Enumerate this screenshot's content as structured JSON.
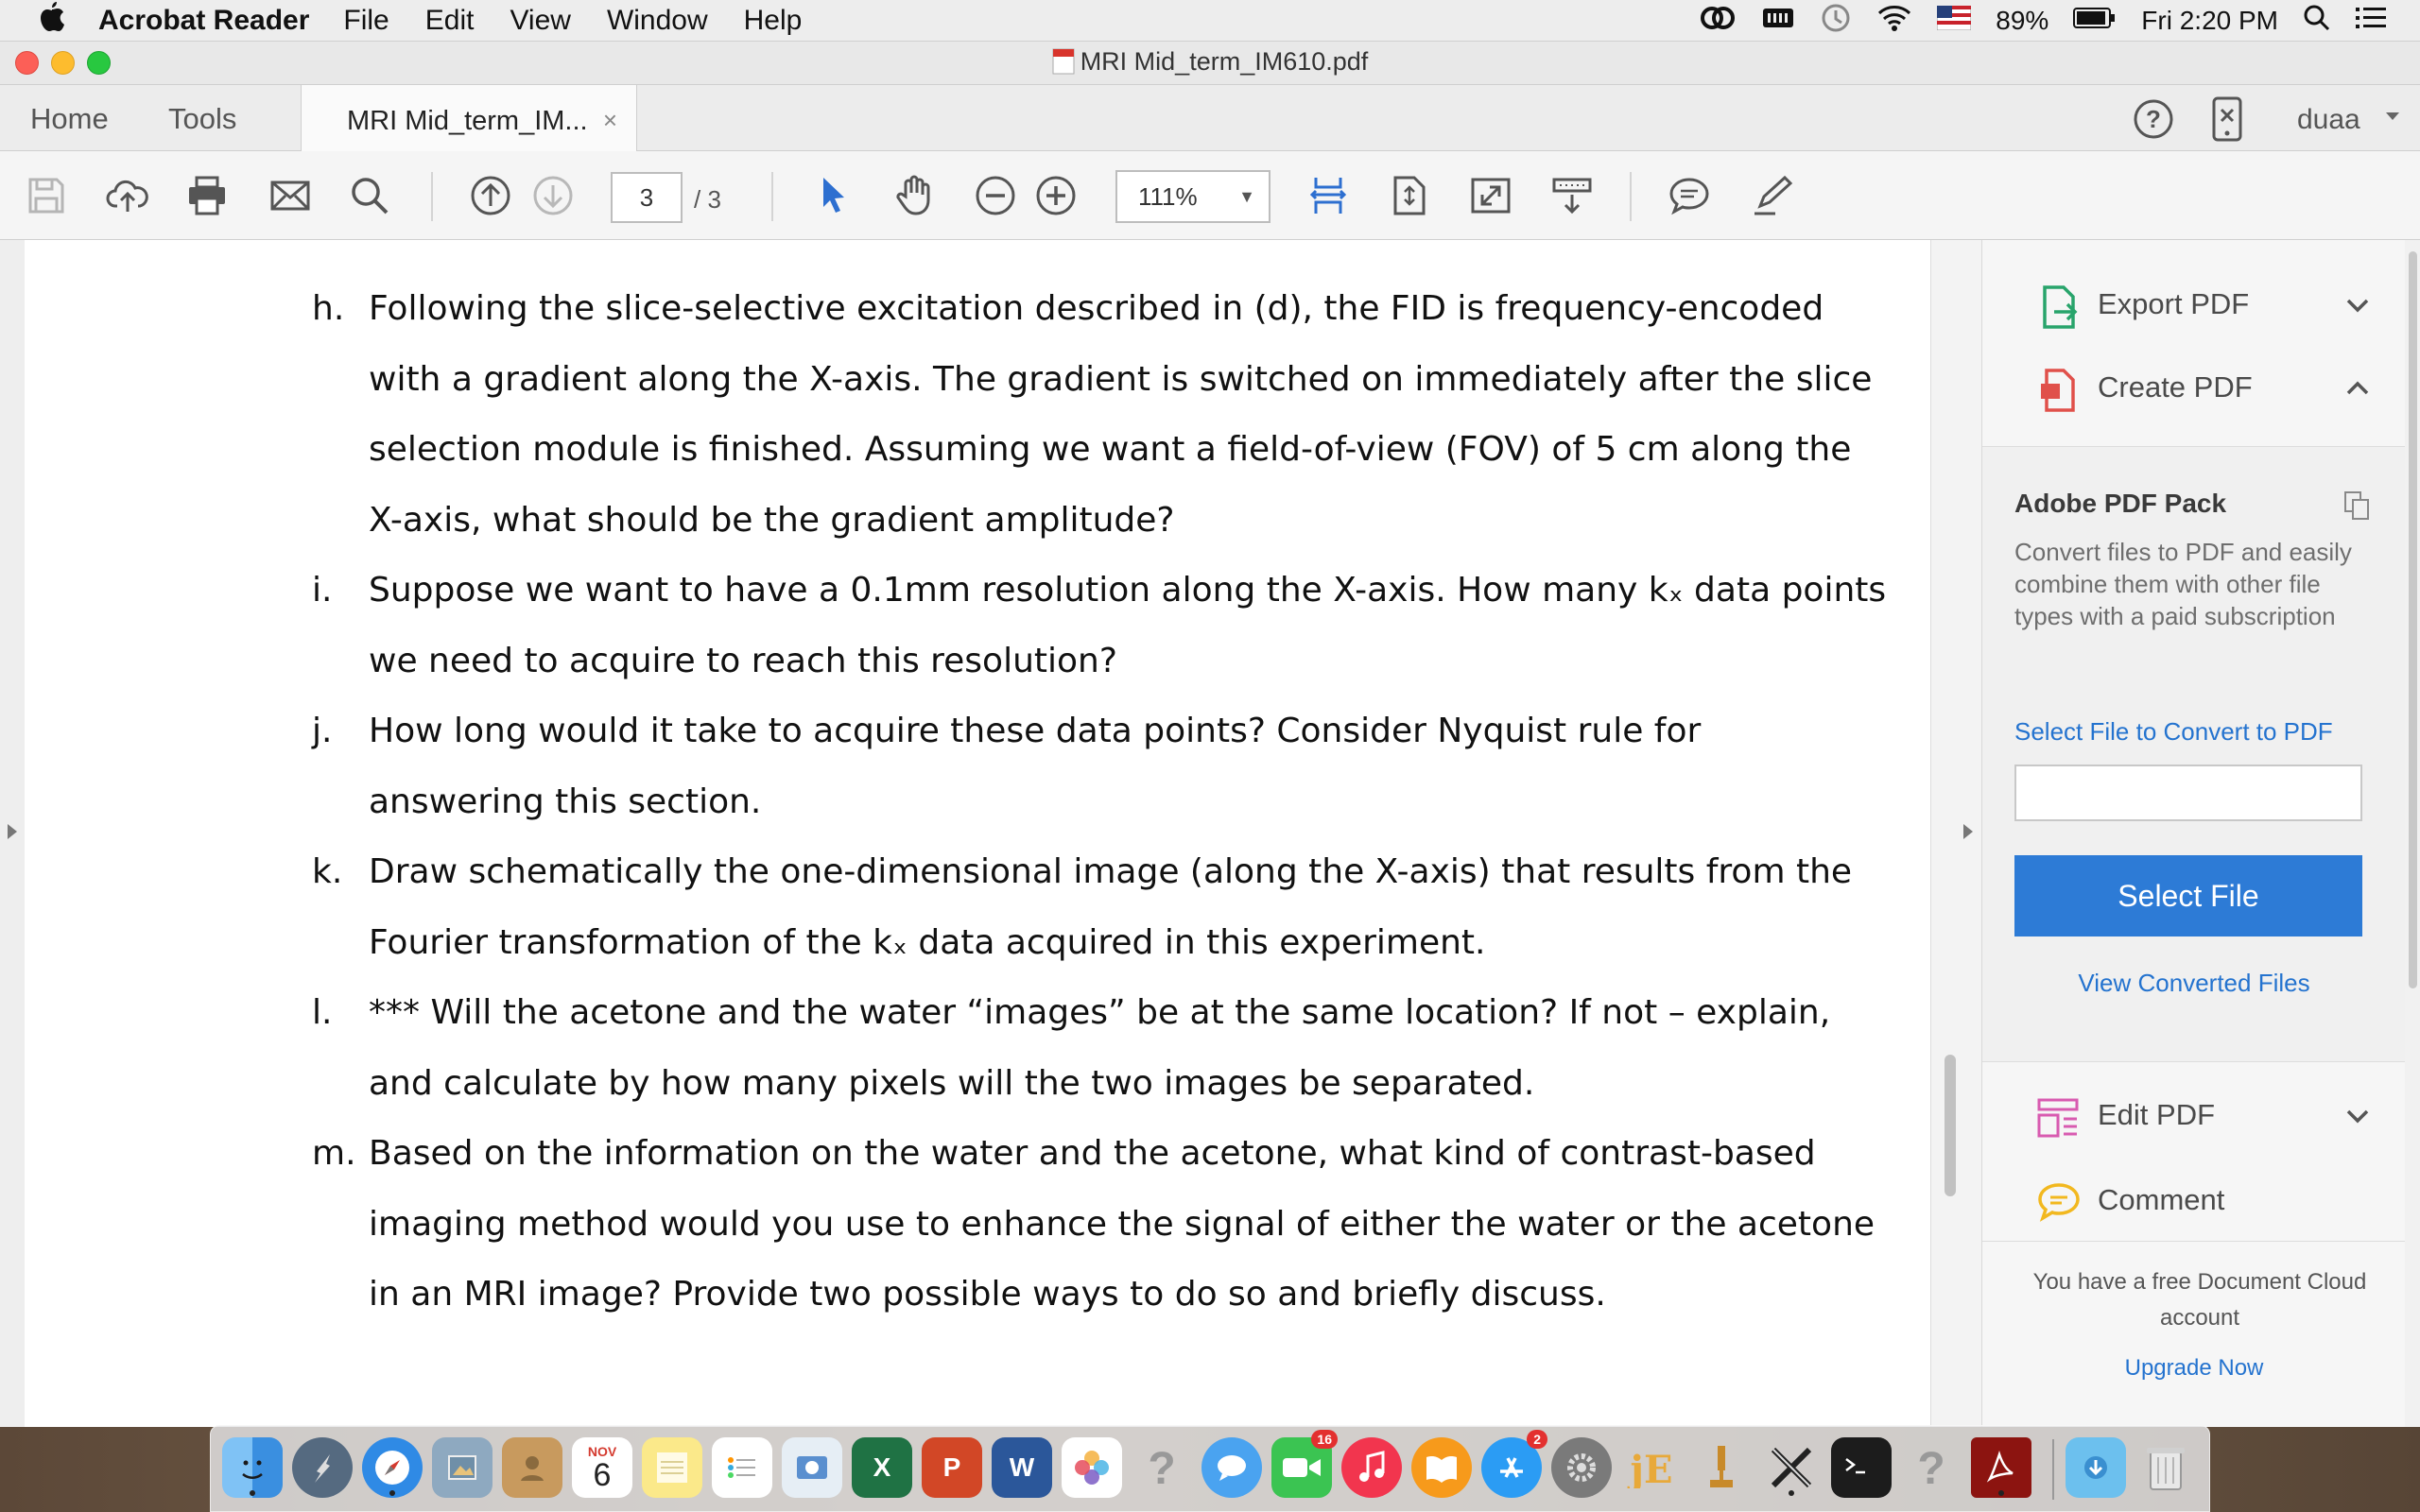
{
  "menubar": {
    "apple": "",
    "app_name": "Acrobat Reader",
    "items": [
      "File",
      "Edit",
      "View",
      "Window",
      "Help"
    ],
    "battery": "89%",
    "clock": "Fri 2:20 PM"
  },
  "window": {
    "title": "MRI Mid_term_IM610.pdf"
  },
  "tabs": {
    "home": "Home",
    "tools": "Tools",
    "doc_tab": "MRI Mid_term_IM...",
    "close": "×",
    "user": "duaa"
  },
  "toolbar": {
    "page_current": "3",
    "page_total": "/ 3",
    "zoom": "111%"
  },
  "document": {
    "questions": [
      {
        "label": "h.",
        "lines": [
          "Following the slice-selective excitation described in (d), the FID is frequency-encoded",
          "with a gradient along the X-axis. The gradient is switched on immediately after the slice",
          "selection module is finished. Assuming we want a field-of-view (FOV) of 5 cm along the",
          "X-axis, what should be the gradient amplitude?"
        ]
      },
      {
        "label": "i.",
        "lines": [
          "Suppose we want to have a 0.1mm resolution along the X-axis. How many kₓ data points",
          "we need to acquire to reach this resolution?"
        ]
      },
      {
        "label": "j.",
        "lines": [
          "How long would it take to acquire these data points? Consider Nyquist rule for",
          "answering this section."
        ]
      },
      {
        "label": "k.",
        "lines": [
          "Draw schematically the one-dimensional image (along the X-axis) that results from the",
          "Fourier transformation of the kₓ data acquired in this experiment."
        ]
      },
      {
        "label": "l.",
        "lines": [
          "*** Will the acetone and the water “images” be at the same location? If not – explain,",
          "and calculate by how many pixels will the two images be separated."
        ]
      },
      {
        "label": "m.",
        "lines": [
          "Based on the information on the water and the acetone, what kind of contrast-based",
          "imaging method would you use to enhance the signal of either the water or the acetone",
          "in an MRI image? Provide two possible ways to do so and briefly discuss."
        ]
      }
    ]
  },
  "panel": {
    "export_pdf": "Export PDF",
    "create_pdf": "Create PDF",
    "pack_title": "Adobe PDF Pack",
    "pack_desc": "Convert files to PDF and easily combine them with other file types with a paid subscription",
    "select_link": "Select File to Convert to PDF",
    "select_button": "Select File",
    "view_converted": "View Converted Files",
    "edit_pdf": "Edit PDF",
    "comment": "Comment",
    "free_note": "You have a free Document Cloud account",
    "upgrade": "Upgrade Now"
  },
  "dock": {
    "calendar_month": "NOV",
    "calendar_day": "6",
    "facetime_badge": "16",
    "appstore_badge": "2",
    "excel_letter": "X",
    "powerpoint_letter": "P",
    "word_letter": "W"
  },
  "colors": {
    "accent_blue": "#2d7bd6",
    "link_blue": "#2473cf",
    "export_green": "#28a46b",
    "create_red": "#e0504a",
    "edit_pink": "#d85bb0",
    "comment_yellow": "#f2b81f"
  }
}
